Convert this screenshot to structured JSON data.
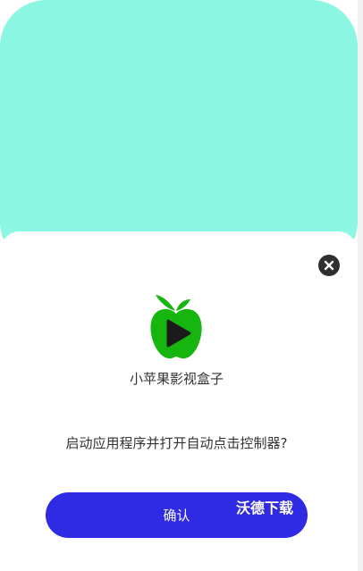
{
  "dialog": {
    "app_name": "小苹果影视盒子",
    "prompt": "启动应用程序并打开自动点击控制器?",
    "confirm_label": "确认"
  },
  "watermark": "沃德下载",
  "icons": {
    "close": "close-icon",
    "logo": "green-apple-play-logo"
  },
  "colors": {
    "background_card": "#8bf7e3",
    "confirm_button": "#2f2ae4",
    "logo_green": "#16b60f",
    "close_button": "#2f2f2f"
  }
}
